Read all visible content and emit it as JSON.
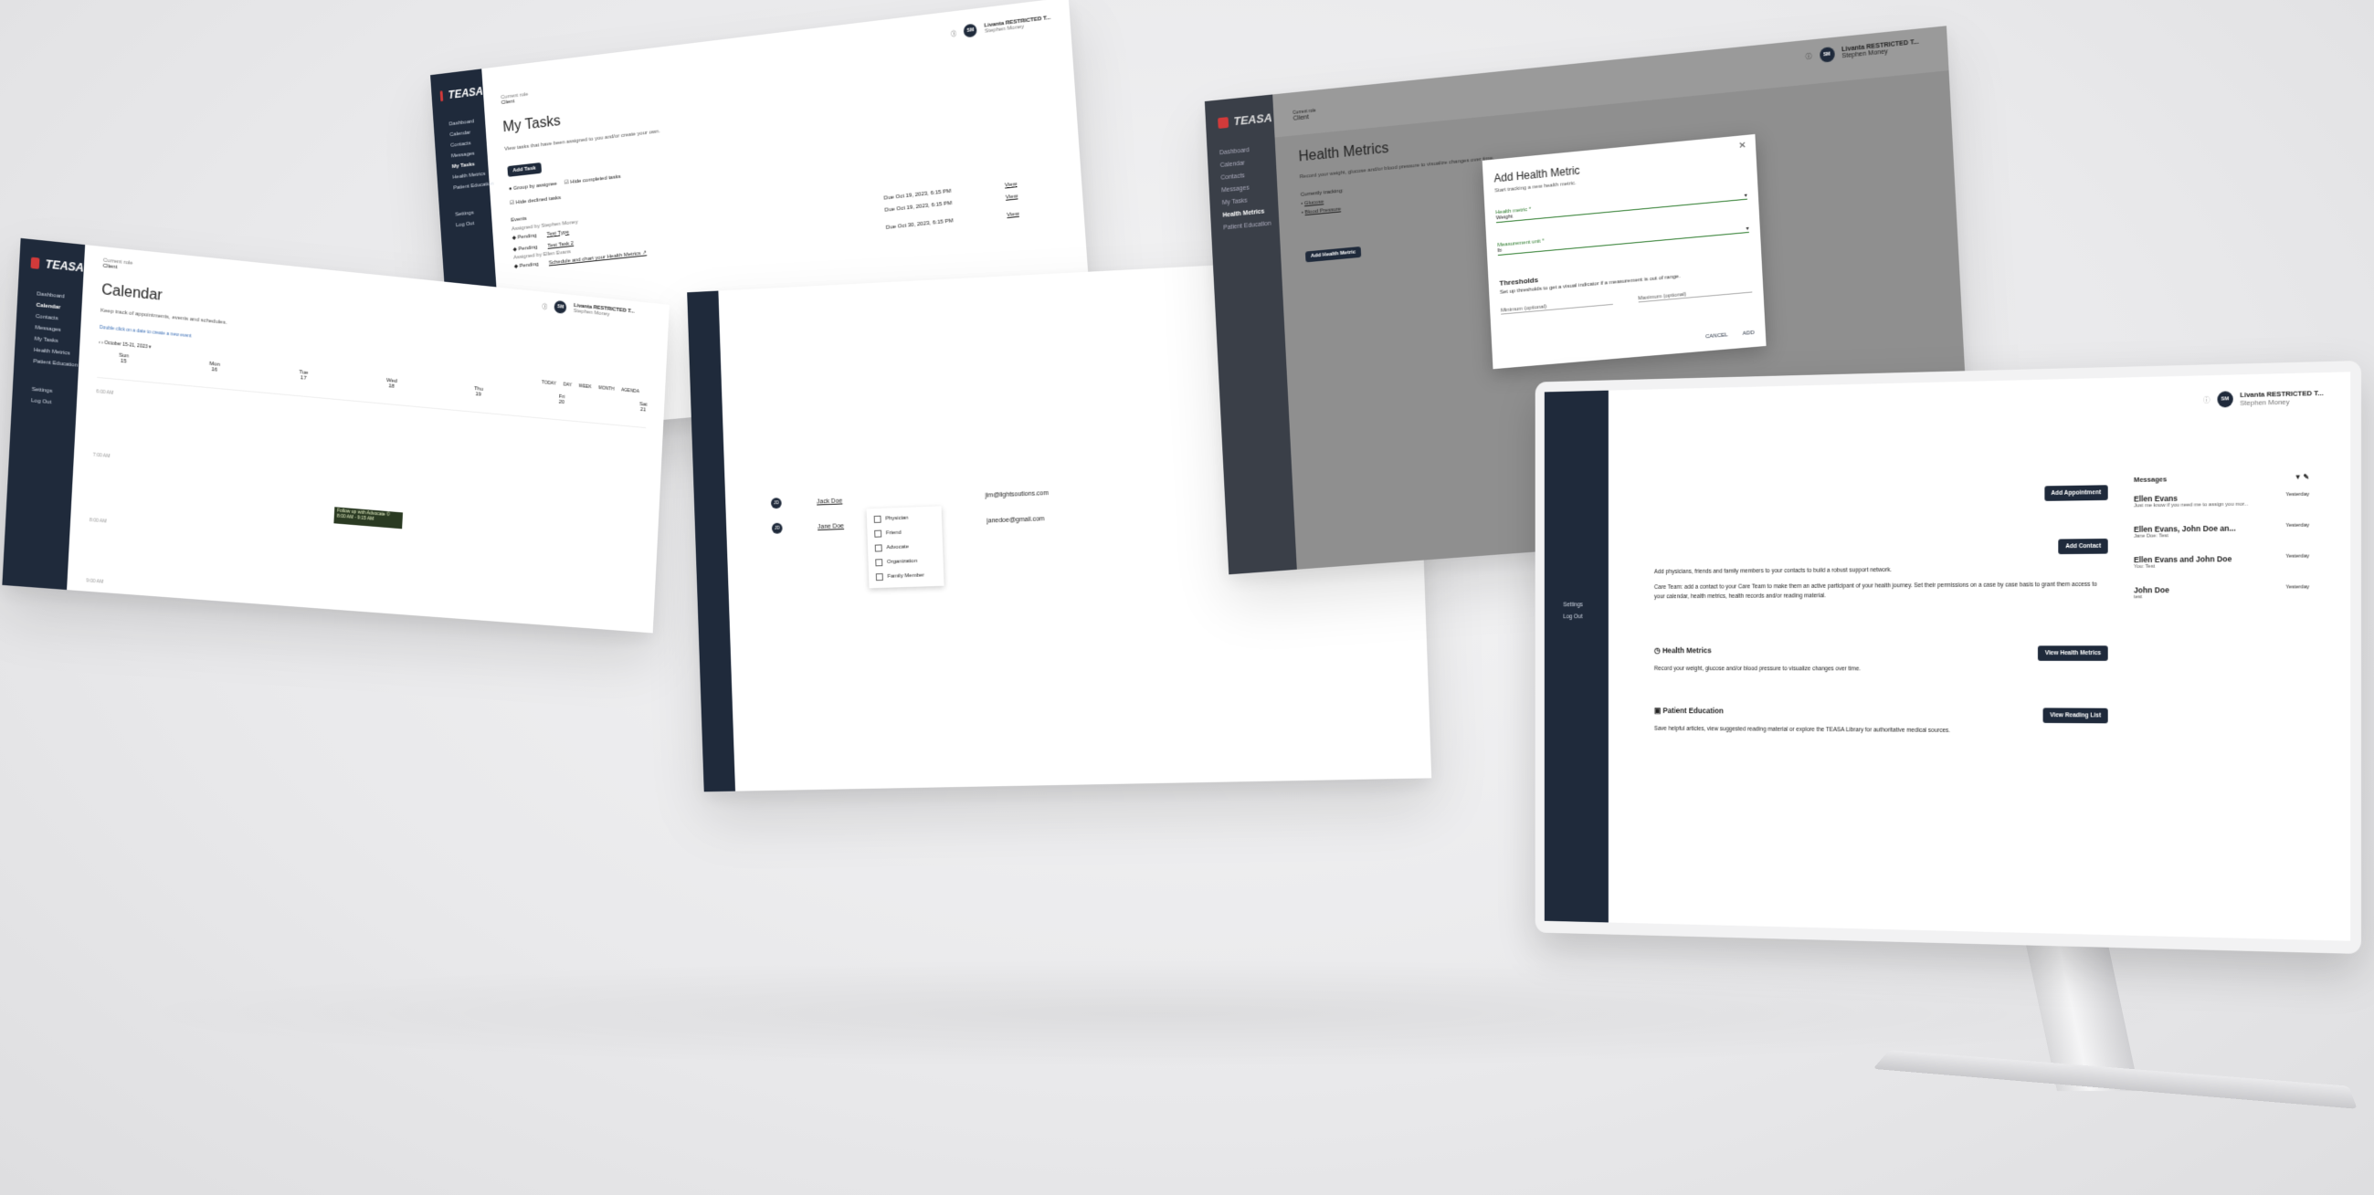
{
  "user": {
    "initials": "SM",
    "org": "Livanta RESTRICTED T...",
    "name": "Stephen Money"
  },
  "brand": "TEASA",
  "tasks_panel": {
    "crumb_top": "Current role",
    "crumb": "Client",
    "title": "My Tasks",
    "subtitle": "View tasks that have been assigned to you and/or create your own.",
    "add_label": "Add Task",
    "opt_group": "Group by assignee",
    "opt_hide_completed": "Hide completed tasks",
    "opt_hide_declined": "Hide declined tasks",
    "section": "Events",
    "nav": [
      "Dashboard",
      "Calendar",
      "Contacts",
      "Messages",
      "My Tasks",
      "Health Metrics",
      "Patient Education",
      "Settings",
      "Log Out"
    ],
    "groups": [
      {
        "assigned": "Assigned by Stephen Money",
        "rows": [
          {
            "status": "Pending",
            "name": "Test Type",
            "due": "Due Oct 19, 2023, 6:15 PM",
            "action": "View"
          },
          {
            "status": "Pending",
            "name": "Test Task 2",
            "due": "Due Oct 19, 2023, 6:15 PM",
            "action": "View"
          }
        ]
      },
      {
        "assigned": "Assigned by Ellen Evans",
        "rows": [
          {
            "status": "Pending",
            "name": "Schedule and chart your Health Metrics ↗",
            "due": "Due Oct 30, 2023, 6:15 PM",
            "action": "View"
          }
        ]
      }
    ]
  },
  "calendar_panel": {
    "crumb_top": "Current role",
    "crumb": "Client",
    "title": "Calendar",
    "subtitle": "Keep track of appointments, events and schedules.",
    "link": "Double click on a date to create a new event",
    "range": "October 15-21, 2023",
    "views": [
      "TODAY",
      "DAY",
      "WEEK",
      "MONTH",
      "AGENDA"
    ],
    "nav": [
      "Dashboard",
      "Calendar",
      "Contacts",
      "Messages",
      "My Tasks",
      "Health Metrics",
      "Patient Education",
      "Settings",
      "Log Out"
    ],
    "days": [
      {
        "d": "Sun",
        "n": "15"
      },
      {
        "d": "Mon",
        "n": "16"
      },
      {
        "d": "Tue",
        "n": "17"
      },
      {
        "d": "Wed",
        "n": "18"
      },
      {
        "d": "Thu",
        "n": "19"
      },
      {
        "d": "Fri",
        "n": "20"
      },
      {
        "d": "Sat",
        "n": "21"
      }
    ],
    "hours": [
      "6:00 AM",
      "7:00 AM",
      "8:00 AM",
      "9:00 AM"
    ],
    "event": "Follow up with Advocate ©\n8:00 AM - 9:15 AM"
  },
  "contacts_panel": {
    "rows": [
      {
        "initials": "JD",
        "name": "Jack Doe",
        "email": "jim@lightsoutions.com"
      },
      {
        "initials": "JD",
        "name": "Jane Doe",
        "email": "janedoe@gmail.com"
      }
    ],
    "menu": [
      "Physician",
      "Friend",
      "Advocate",
      "Organization",
      "Family Member"
    ]
  },
  "health_panel": {
    "crumb_top": "Current role",
    "crumb": "Client",
    "title": "Health Metrics",
    "subtitle": "Record your weight, glucose and/or blood pressure to visualize changes over time.",
    "tracking_label": "Currently tracking:",
    "tracking": [
      "Glucose",
      "Blood Pressure"
    ],
    "add_label": "Add Health Metric",
    "nav": [
      "Dashboard",
      "Calendar",
      "Contacts",
      "Messages",
      "My Tasks",
      "Health Metrics",
      "Patient Education"
    ],
    "modal": {
      "title": "Add Health Metric",
      "subtitle": "Start tracking a new health metric.",
      "field1_label": "Health metric *",
      "field1_value": "Weight",
      "field2_label": "Measurement unit *",
      "field2_value": "lb",
      "thresholds": "Thresholds",
      "thresholds_desc": "Set up thresholds to get a visual indicator if a measurement is out of range.",
      "min": "Minimum (optional)",
      "max": "Maximum (optional)",
      "cancel": "CANCEL",
      "add": "ADD"
    }
  },
  "monitor": {
    "nav": [
      "Settings",
      "Log Out"
    ],
    "appointments_btn": "Add Appointment",
    "contacts_btn": "Add Contact",
    "contacts_desc": "Add physicians, friends and family members to your contacts to build a robust support network.",
    "care_team_desc": "Care Team: add a contact to your Care Team to make them an active participant of your health journey. Set their permissions on a case by case basis to grant them access to your calendar, health metrics, health records and/or reading material.",
    "health_title": "Health Metrics",
    "health_desc": "Record your weight, glucose and/or blood pressure to visualize changes over time.",
    "health_btn": "View Health Metrics",
    "edu_title": "Patient Education",
    "edu_desc": "Save helpful articles, view suggested reading material or explore the TEASA Library for authoritative medical sources.",
    "edu_btn": "View Reading List",
    "messages_title": "Messages",
    "messages": [
      {
        "from": "Ellen Evans",
        "time": "Yesterday",
        "preview": "Just me know if you need me to assign you mor..."
      },
      {
        "from": "Ellen Evans, John Doe an...",
        "time": "Yesterday",
        "preview": "Jane Doe: Test"
      },
      {
        "from": "Ellen Evans and John Doe",
        "time": "Yesterday",
        "preview": "You: Test"
      },
      {
        "from": "John Doe",
        "time": "Yesterday",
        "preview": "test"
      }
    ]
  },
  "colors": {
    "sidebar": "#1f2a3b",
    "accent": "#d23a3a"
  }
}
